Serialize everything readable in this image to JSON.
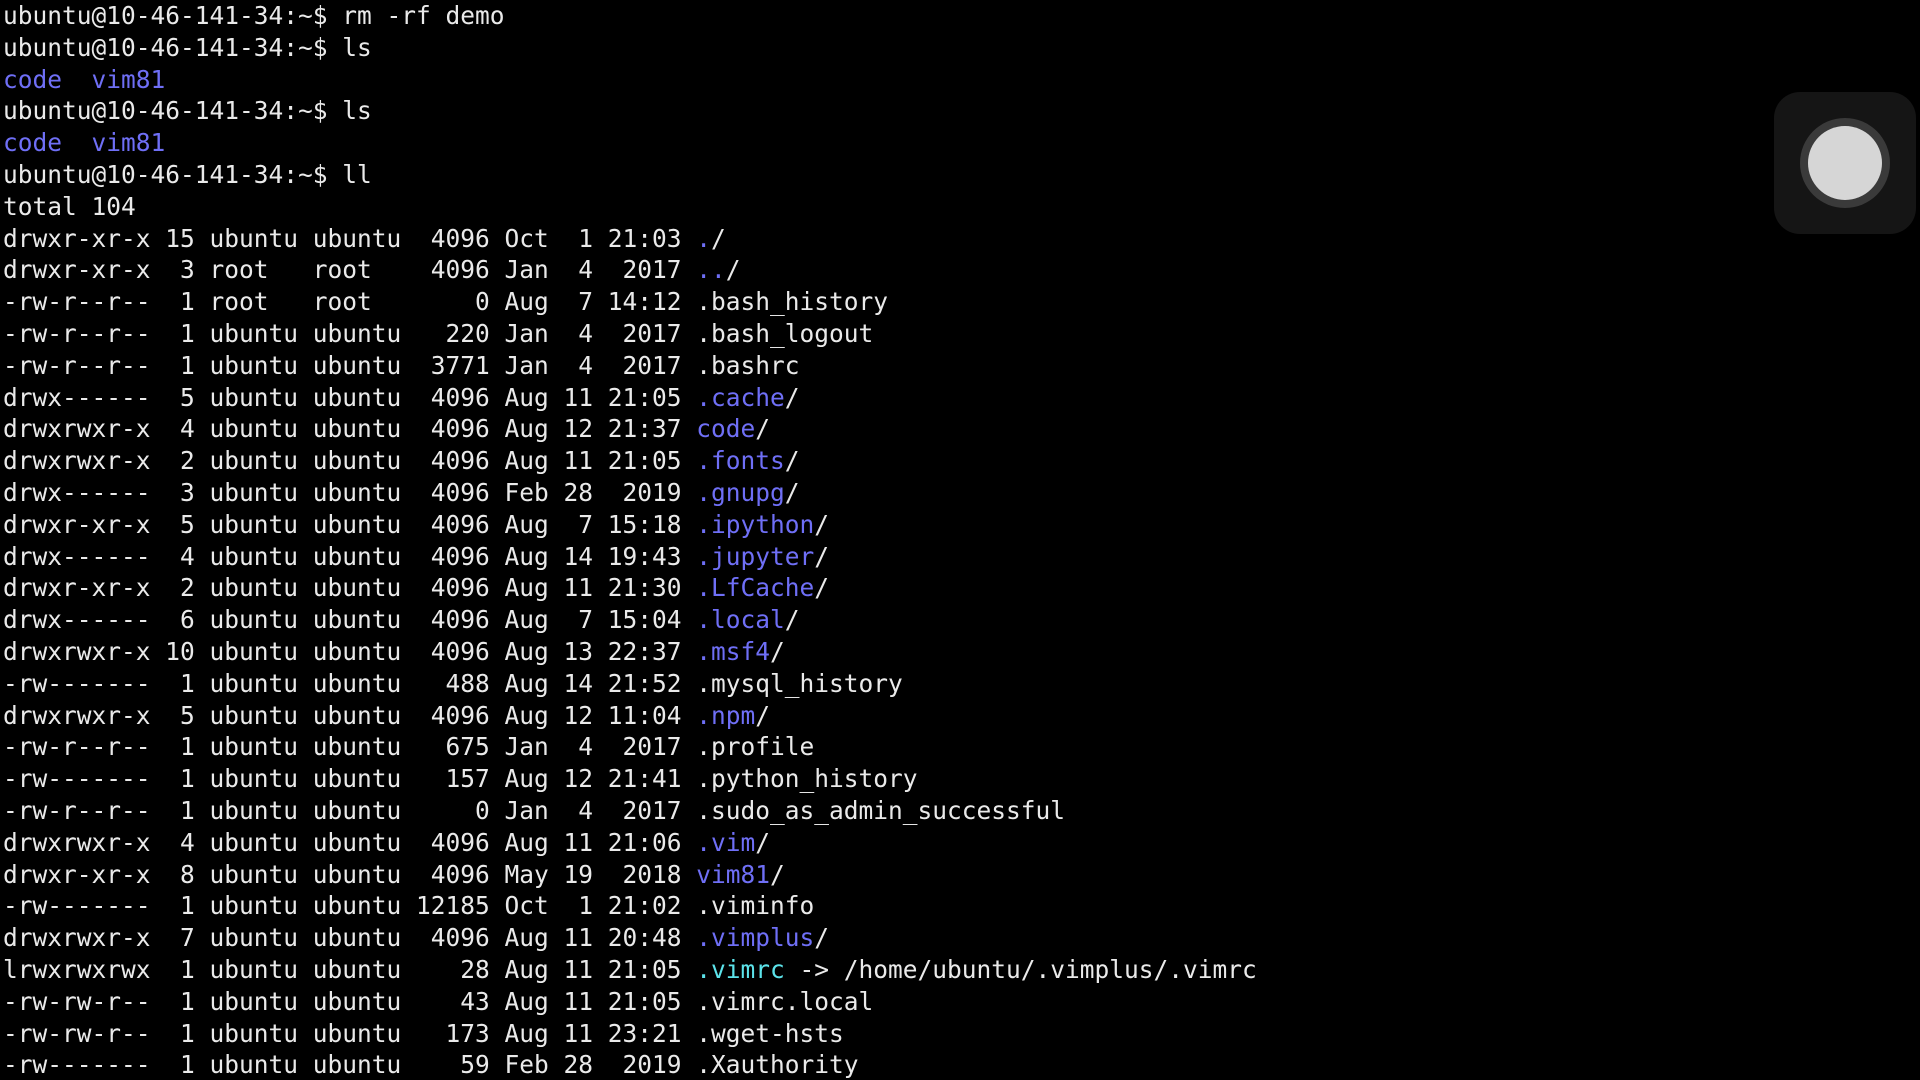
{
  "colors": {
    "background": "#000000",
    "text": "#eaeaea",
    "directory": "#6f6ff6",
    "symlink": "#5ce3ea"
  },
  "terminal": {
    "lines": [
      [
        {
          "text": "ubuntu@10-46-141-34:~$ rm -rf demo",
          "kind": "plain"
        }
      ],
      [
        {
          "text": "ubuntu@10-46-141-34:~$ ls",
          "kind": "plain"
        }
      ],
      [
        {
          "text": "code",
          "kind": "dir"
        },
        {
          "text": "  ",
          "kind": "plain"
        },
        {
          "text": "vim81",
          "kind": "dir"
        }
      ],
      [
        {
          "text": "ubuntu@10-46-141-34:~$ ls",
          "kind": "plain"
        }
      ],
      [
        {
          "text": "code",
          "kind": "dir"
        },
        {
          "text": "  ",
          "kind": "plain"
        },
        {
          "text": "vim81",
          "kind": "dir"
        }
      ],
      [
        {
          "text": "ubuntu@10-46-141-34:~$ ll",
          "kind": "plain"
        }
      ],
      [
        {
          "text": "total 104",
          "kind": "plain"
        }
      ],
      [
        {
          "text": "drwxr-xr-x 15 ubuntu ubuntu  4096 Oct  1 21:03 ",
          "kind": "plain"
        },
        {
          "text": ".",
          "kind": "dir"
        },
        {
          "text": "/",
          "kind": "plain"
        }
      ],
      [
        {
          "text": "drwxr-xr-x  3 root   root    4096 Jan  4  2017 ",
          "kind": "plain"
        },
        {
          "text": "..",
          "kind": "dir"
        },
        {
          "text": "/",
          "kind": "plain"
        }
      ],
      [
        {
          "text": "-rw-r--r--  1 root   root       0 Aug  7 14:12 .bash_history",
          "kind": "plain"
        }
      ],
      [
        {
          "text": "-rw-r--r--  1 ubuntu ubuntu   220 Jan  4  2017 .bash_logout",
          "kind": "plain"
        }
      ],
      [
        {
          "text": "-rw-r--r--  1 ubuntu ubuntu  3771 Jan  4  2017 .bashrc",
          "kind": "plain"
        }
      ],
      [
        {
          "text": "drwx------  5 ubuntu ubuntu  4096 Aug 11 21:05 ",
          "kind": "plain"
        },
        {
          "text": ".cache",
          "kind": "dir"
        },
        {
          "text": "/",
          "kind": "plain"
        }
      ],
      [
        {
          "text": "drwxrwxr-x  4 ubuntu ubuntu  4096 Aug 12 21:37 ",
          "kind": "plain"
        },
        {
          "text": "code",
          "kind": "dir"
        },
        {
          "text": "/",
          "kind": "plain"
        }
      ],
      [
        {
          "text": "drwxrwxr-x  2 ubuntu ubuntu  4096 Aug 11 21:05 ",
          "kind": "plain"
        },
        {
          "text": ".fonts",
          "kind": "dir"
        },
        {
          "text": "/",
          "kind": "plain"
        }
      ],
      [
        {
          "text": "drwx------  3 ubuntu ubuntu  4096 Feb 28  2019 ",
          "kind": "plain"
        },
        {
          "text": ".gnupg",
          "kind": "dir"
        },
        {
          "text": "/",
          "kind": "plain"
        }
      ],
      [
        {
          "text": "drwxr-xr-x  5 ubuntu ubuntu  4096 Aug  7 15:18 ",
          "kind": "plain"
        },
        {
          "text": ".ipython",
          "kind": "dir"
        },
        {
          "text": "/",
          "kind": "plain"
        }
      ],
      [
        {
          "text": "drwx------  4 ubuntu ubuntu  4096 Aug 14 19:43 ",
          "kind": "plain"
        },
        {
          "text": ".jupyter",
          "kind": "dir"
        },
        {
          "text": "/",
          "kind": "plain"
        }
      ],
      [
        {
          "text": "drwxr-xr-x  2 ubuntu ubuntu  4096 Aug 11 21:30 ",
          "kind": "plain"
        },
        {
          "text": ".LfCache",
          "kind": "dir"
        },
        {
          "text": "/",
          "kind": "plain"
        }
      ],
      [
        {
          "text": "drwx------  6 ubuntu ubuntu  4096 Aug  7 15:04 ",
          "kind": "plain"
        },
        {
          "text": ".local",
          "kind": "dir"
        },
        {
          "text": "/",
          "kind": "plain"
        }
      ],
      [
        {
          "text": "drwxrwxr-x 10 ubuntu ubuntu  4096 Aug 13 22:37 ",
          "kind": "plain"
        },
        {
          "text": ".msf4",
          "kind": "dir"
        },
        {
          "text": "/",
          "kind": "plain"
        }
      ],
      [
        {
          "text": "-rw-------  1 ubuntu ubuntu   488 Aug 14 21:52 .mysql_history",
          "kind": "plain"
        }
      ],
      [
        {
          "text": "drwxrwxr-x  5 ubuntu ubuntu  4096 Aug 12 11:04 ",
          "kind": "plain"
        },
        {
          "text": ".npm",
          "kind": "dir"
        },
        {
          "text": "/",
          "kind": "plain"
        }
      ],
      [
        {
          "text": "-rw-r--r--  1 ubuntu ubuntu   675 Jan  4  2017 .profile",
          "kind": "plain"
        }
      ],
      [
        {
          "text": "-rw-------  1 ubuntu ubuntu   157 Aug 12 21:41 .python_history",
          "kind": "plain"
        }
      ],
      [
        {
          "text": "-rw-r--r--  1 ubuntu ubuntu     0 Jan  4  2017 .sudo_as_admin_successful",
          "kind": "plain"
        }
      ],
      [
        {
          "text": "drwxrwxr-x  4 ubuntu ubuntu  4096 Aug 11 21:06 ",
          "kind": "plain"
        },
        {
          "text": ".vim",
          "kind": "dir"
        },
        {
          "text": "/",
          "kind": "plain"
        }
      ],
      [
        {
          "text": "drwxr-xr-x  8 ubuntu ubuntu  4096 May 19  2018 ",
          "kind": "plain"
        },
        {
          "text": "vim81",
          "kind": "dir"
        },
        {
          "text": "/",
          "kind": "plain"
        }
      ],
      [
        {
          "text": "-rw-------  1 ubuntu ubuntu 12185 Oct  1 21:02 .viminfo",
          "kind": "plain"
        }
      ],
      [
        {
          "text": "drwxrwxr-x  7 ubuntu ubuntu  4096 Aug 11 20:48 ",
          "kind": "plain"
        },
        {
          "text": ".vimplus",
          "kind": "dir"
        },
        {
          "text": "/",
          "kind": "plain"
        }
      ],
      [
        {
          "text": "lrwxrwxrwx  1 ubuntu ubuntu    28 Aug 11 21:05 ",
          "kind": "plain"
        },
        {
          "text": ".vimrc",
          "kind": "link"
        },
        {
          "text": " -> /home/ubuntu/.vimplus/.vimrc",
          "kind": "plain"
        }
      ],
      [
        {
          "text": "-rw-rw-r--  1 ubuntu ubuntu    43 Aug 11 21:05 .vimrc.local",
          "kind": "plain"
        }
      ],
      [
        {
          "text": "-rw-rw-r--  1 ubuntu ubuntu   173 Aug 11 23:21 .wget-hsts",
          "kind": "plain"
        }
      ],
      [
        {
          "text": "-rw-------  1 ubuntu ubuntu    59 Feb 28  2019 .Xauthority",
          "kind": "plain"
        }
      ]
    ]
  },
  "overlay": {
    "assistive_touch_icon": "assistive-touch-icon"
  }
}
